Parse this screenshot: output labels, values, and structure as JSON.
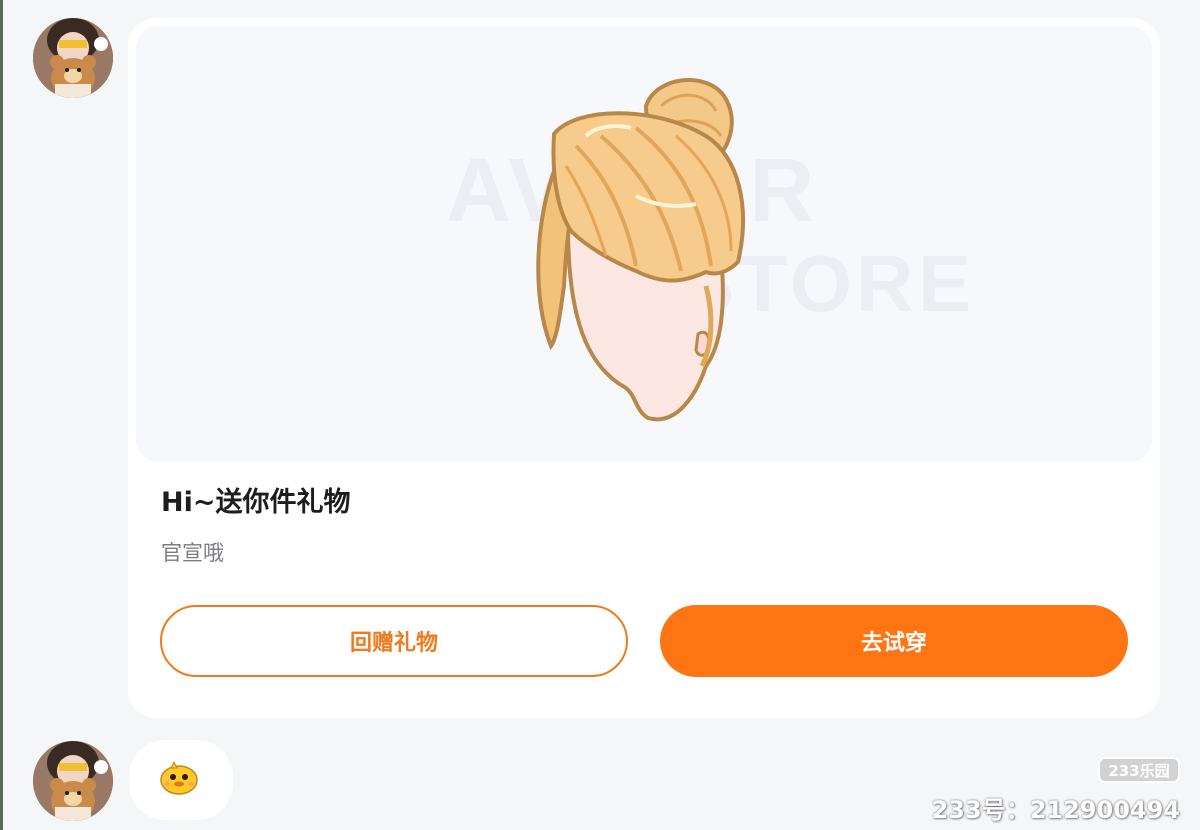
{
  "chat": {
    "gift_card": {
      "title": "Hi~送你件礼物",
      "message": "官宣哦",
      "return_gift_label": "回赠礼物",
      "try_on_label": "去试穿",
      "image_watermark_line1": "AVATAR",
      "image_watermark_line2": "STORE"
    },
    "emoji_message": {
      "icon": "yellow-chick-emoji"
    }
  },
  "overlay": {
    "site_badge": "233乐园",
    "user_id": "233号：212900494"
  },
  "colors": {
    "accent": "#ff7413",
    "background": "#f5f6f8",
    "card": "#ffffff"
  }
}
